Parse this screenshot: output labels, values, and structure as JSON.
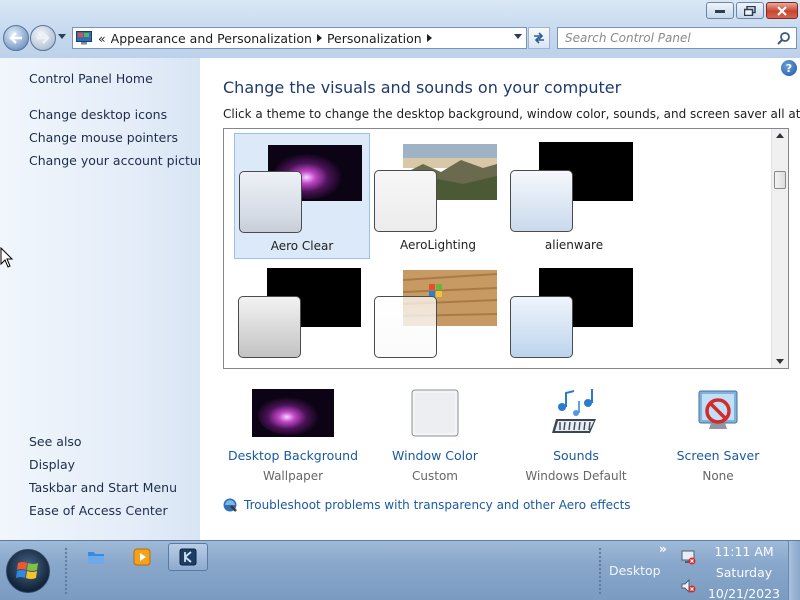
{
  "address_bar": {
    "breadcrumb": [
      "Appearance and Personalization",
      "Personalization"
    ],
    "chevron": "«"
  },
  "search": {
    "placeholder": "Search Control Panel"
  },
  "left_pane": {
    "home": "Control Panel Home",
    "links": [
      "Change desktop icons",
      "Change mouse pointers",
      "Change your account picture"
    ],
    "see_also_label": "See also",
    "see_also": [
      "Display",
      "Taskbar and Start Menu",
      "Ease of Access Center"
    ]
  },
  "main": {
    "heading": "Change the visuals and sounds on your computer",
    "subheading": "Click a theme to change the desktop background, window color, sounds, and screen saver all at once.",
    "themes": [
      {
        "name": "Aero Clear",
        "selected": true,
        "wallpaper": "purple-nebula",
        "glass": "clear"
      },
      {
        "name": "AeroLighting",
        "selected": false,
        "wallpaper": "landscape",
        "glass": "clear"
      },
      {
        "name": "alienware",
        "selected": false,
        "wallpaper": "black",
        "glass": "blue"
      },
      {
        "name": "",
        "selected": false,
        "wallpaper": "black",
        "glass": "grey"
      },
      {
        "name": "",
        "selected": false,
        "wallpaper": "windows7-wood",
        "glass": "clear"
      },
      {
        "name": "",
        "selected": false,
        "wallpaper": "black",
        "glass": "blue"
      }
    ],
    "options": [
      {
        "label": "Desktop Background",
        "sub": "Wallpaper",
        "icon": "wallpaper-thumbnail-icon"
      },
      {
        "label": "Window Color",
        "sub": "Custom",
        "icon": "window-color-swatch-icon"
      },
      {
        "label": "Sounds",
        "sub": "Windows Default",
        "icon": "sounds-icon"
      },
      {
        "label": "Screen Saver",
        "sub": "None",
        "icon": "screen-saver-icon"
      }
    ],
    "troubleshoot": "Troubleshoot problems with transparency and other Aero effects"
  },
  "taskbar": {
    "desktop_label": "Desktop",
    "time": "11:11 AM",
    "day": "Saturday",
    "date": "10/21/2023"
  },
  "colors": {
    "link": "#1a5aa0",
    "heading": "#1e3a6e",
    "taskbar": "#88a7cb",
    "selected_theme": "#dbe9f9"
  }
}
